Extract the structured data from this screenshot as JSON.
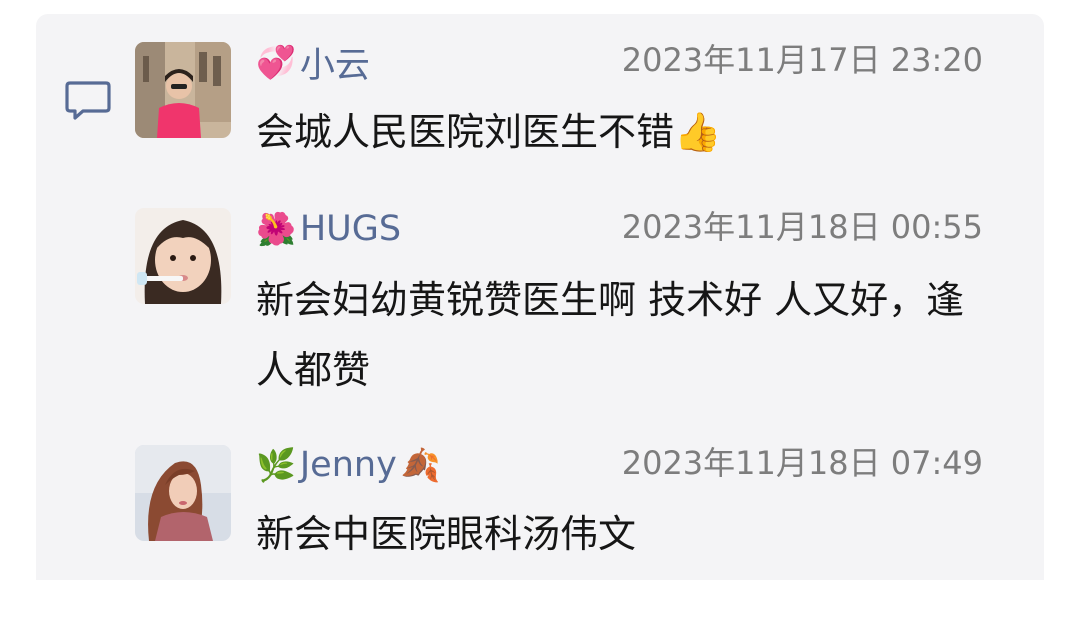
{
  "comments": [
    {
      "name_prefix_emoji": "💞",
      "name": "小云",
      "name_suffix_emoji": "",
      "time": "2023年11月17日 23:20",
      "text": "会城人民医院刘医生不错👍"
    },
    {
      "name_prefix_emoji": "🌺",
      "name": "HUGS",
      "name_suffix_emoji": "",
      "time": "2023年11月18日 00:55",
      "text": "新会妇幼黄锐赞医生啊  技术好 人又好，逢人都赞"
    },
    {
      "name_prefix_emoji": "🌿",
      "name": "Jenny",
      "name_suffix_emoji": "🍂",
      "time": "2023年11月18日 07:49",
      "text": "新会中医院眼科汤伟文"
    }
  ],
  "colors": {
    "panel_bg": "#f4f4f6",
    "name": "#576b95",
    "time": "#7d7d7d",
    "text": "#161616"
  },
  "icons": {
    "comment": "comment-bubble-icon"
  }
}
